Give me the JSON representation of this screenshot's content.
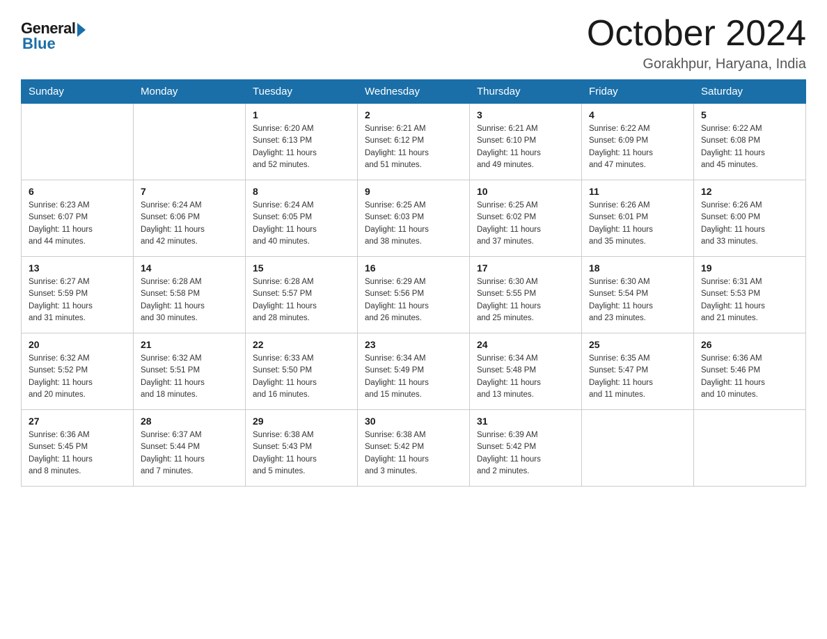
{
  "logo": {
    "general": "General",
    "blue": "Blue"
  },
  "title": "October 2024",
  "location": "Gorakhpur, Haryana, India",
  "days_header": [
    "Sunday",
    "Monday",
    "Tuesday",
    "Wednesday",
    "Thursday",
    "Friday",
    "Saturday"
  ],
  "weeks": [
    [
      {
        "day": "",
        "detail": ""
      },
      {
        "day": "",
        "detail": ""
      },
      {
        "day": "1",
        "detail": "Sunrise: 6:20 AM\nSunset: 6:13 PM\nDaylight: 11 hours\nand 52 minutes."
      },
      {
        "day": "2",
        "detail": "Sunrise: 6:21 AM\nSunset: 6:12 PM\nDaylight: 11 hours\nand 51 minutes."
      },
      {
        "day": "3",
        "detail": "Sunrise: 6:21 AM\nSunset: 6:10 PM\nDaylight: 11 hours\nand 49 minutes."
      },
      {
        "day": "4",
        "detail": "Sunrise: 6:22 AM\nSunset: 6:09 PM\nDaylight: 11 hours\nand 47 minutes."
      },
      {
        "day": "5",
        "detail": "Sunrise: 6:22 AM\nSunset: 6:08 PM\nDaylight: 11 hours\nand 45 minutes."
      }
    ],
    [
      {
        "day": "6",
        "detail": "Sunrise: 6:23 AM\nSunset: 6:07 PM\nDaylight: 11 hours\nand 44 minutes."
      },
      {
        "day": "7",
        "detail": "Sunrise: 6:24 AM\nSunset: 6:06 PM\nDaylight: 11 hours\nand 42 minutes."
      },
      {
        "day": "8",
        "detail": "Sunrise: 6:24 AM\nSunset: 6:05 PM\nDaylight: 11 hours\nand 40 minutes."
      },
      {
        "day": "9",
        "detail": "Sunrise: 6:25 AM\nSunset: 6:03 PM\nDaylight: 11 hours\nand 38 minutes."
      },
      {
        "day": "10",
        "detail": "Sunrise: 6:25 AM\nSunset: 6:02 PM\nDaylight: 11 hours\nand 37 minutes."
      },
      {
        "day": "11",
        "detail": "Sunrise: 6:26 AM\nSunset: 6:01 PM\nDaylight: 11 hours\nand 35 minutes."
      },
      {
        "day": "12",
        "detail": "Sunrise: 6:26 AM\nSunset: 6:00 PM\nDaylight: 11 hours\nand 33 minutes."
      }
    ],
    [
      {
        "day": "13",
        "detail": "Sunrise: 6:27 AM\nSunset: 5:59 PM\nDaylight: 11 hours\nand 31 minutes."
      },
      {
        "day": "14",
        "detail": "Sunrise: 6:28 AM\nSunset: 5:58 PM\nDaylight: 11 hours\nand 30 minutes."
      },
      {
        "day": "15",
        "detail": "Sunrise: 6:28 AM\nSunset: 5:57 PM\nDaylight: 11 hours\nand 28 minutes."
      },
      {
        "day": "16",
        "detail": "Sunrise: 6:29 AM\nSunset: 5:56 PM\nDaylight: 11 hours\nand 26 minutes."
      },
      {
        "day": "17",
        "detail": "Sunrise: 6:30 AM\nSunset: 5:55 PM\nDaylight: 11 hours\nand 25 minutes."
      },
      {
        "day": "18",
        "detail": "Sunrise: 6:30 AM\nSunset: 5:54 PM\nDaylight: 11 hours\nand 23 minutes."
      },
      {
        "day": "19",
        "detail": "Sunrise: 6:31 AM\nSunset: 5:53 PM\nDaylight: 11 hours\nand 21 minutes."
      }
    ],
    [
      {
        "day": "20",
        "detail": "Sunrise: 6:32 AM\nSunset: 5:52 PM\nDaylight: 11 hours\nand 20 minutes."
      },
      {
        "day": "21",
        "detail": "Sunrise: 6:32 AM\nSunset: 5:51 PM\nDaylight: 11 hours\nand 18 minutes."
      },
      {
        "day": "22",
        "detail": "Sunrise: 6:33 AM\nSunset: 5:50 PM\nDaylight: 11 hours\nand 16 minutes."
      },
      {
        "day": "23",
        "detail": "Sunrise: 6:34 AM\nSunset: 5:49 PM\nDaylight: 11 hours\nand 15 minutes."
      },
      {
        "day": "24",
        "detail": "Sunrise: 6:34 AM\nSunset: 5:48 PM\nDaylight: 11 hours\nand 13 minutes."
      },
      {
        "day": "25",
        "detail": "Sunrise: 6:35 AM\nSunset: 5:47 PM\nDaylight: 11 hours\nand 11 minutes."
      },
      {
        "day": "26",
        "detail": "Sunrise: 6:36 AM\nSunset: 5:46 PM\nDaylight: 11 hours\nand 10 minutes."
      }
    ],
    [
      {
        "day": "27",
        "detail": "Sunrise: 6:36 AM\nSunset: 5:45 PM\nDaylight: 11 hours\nand 8 minutes."
      },
      {
        "day": "28",
        "detail": "Sunrise: 6:37 AM\nSunset: 5:44 PM\nDaylight: 11 hours\nand 7 minutes."
      },
      {
        "day": "29",
        "detail": "Sunrise: 6:38 AM\nSunset: 5:43 PM\nDaylight: 11 hours\nand 5 minutes."
      },
      {
        "day": "30",
        "detail": "Sunrise: 6:38 AM\nSunset: 5:42 PM\nDaylight: 11 hours\nand 3 minutes."
      },
      {
        "day": "31",
        "detail": "Sunrise: 6:39 AM\nSunset: 5:42 PM\nDaylight: 11 hours\nand 2 minutes."
      },
      {
        "day": "",
        "detail": ""
      },
      {
        "day": "",
        "detail": ""
      }
    ]
  ]
}
